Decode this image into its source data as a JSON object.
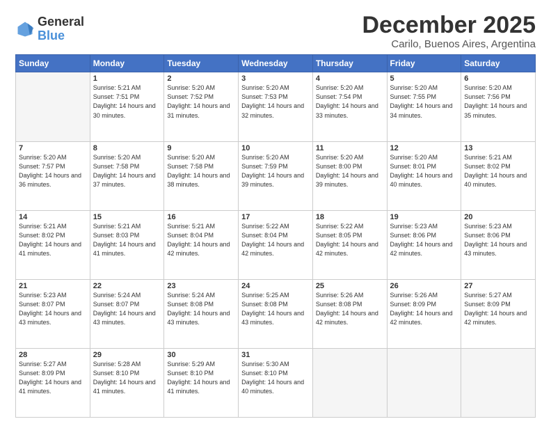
{
  "header": {
    "logo_general": "General",
    "logo_blue": "Blue",
    "title": "December 2025",
    "subtitle": "Carilo, Buenos Aires, Argentina"
  },
  "calendar": {
    "days_of_week": [
      "Sunday",
      "Monday",
      "Tuesday",
      "Wednesday",
      "Thursday",
      "Friday",
      "Saturday"
    ],
    "weeks": [
      [
        {
          "day": "",
          "empty": true
        },
        {
          "day": "1",
          "sunrise": "5:21 AM",
          "sunset": "7:51 PM",
          "daylight": "14 hours and 30 minutes."
        },
        {
          "day": "2",
          "sunrise": "5:20 AM",
          "sunset": "7:52 PM",
          "daylight": "14 hours and 31 minutes."
        },
        {
          "day": "3",
          "sunrise": "5:20 AM",
          "sunset": "7:53 PM",
          "daylight": "14 hours and 32 minutes."
        },
        {
          "day": "4",
          "sunrise": "5:20 AM",
          "sunset": "7:54 PM",
          "daylight": "14 hours and 33 minutes."
        },
        {
          "day": "5",
          "sunrise": "5:20 AM",
          "sunset": "7:55 PM",
          "daylight": "14 hours and 34 minutes."
        },
        {
          "day": "6",
          "sunrise": "5:20 AM",
          "sunset": "7:56 PM",
          "daylight": "14 hours and 35 minutes."
        }
      ],
      [
        {
          "day": "7",
          "sunrise": "5:20 AM",
          "sunset": "7:57 PM",
          "daylight": "14 hours and 36 minutes."
        },
        {
          "day": "8",
          "sunrise": "5:20 AM",
          "sunset": "7:58 PM",
          "daylight": "14 hours and 37 minutes."
        },
        {
          "day": "9",
          "sunrise": "5:20 AM",
          "sunset": "7:58 PM",
          "daylight": "14 hours and 38 minutes."
        },
        {
          "day": "10",
          "sunrise": "5:20 AM",
          "sunset": "7:59 PM",
          "daylight": "14 hours and 39 minutes."
        },
        {
          "day": "11",
          "sunrise": "5:20 AM",
          "sunset": "8:00 PM",
          "daylight": "14 hours and 39 minutes."
        },
        {
          "day": "12",
          "sunrise": "5:20 AM",
          "sunset": "8:01 PM",
          "daylight": "14 hours and 40 minutes."
        },
        {
          "day": "13",
          "sunrise": "5:21 AM",
          "sunset": "8:02 PM",
          "daylight": "14 hours and 40 minutes."
        }
      ],
      [
        {
          "day": "14",
          "sunrise": "5:21 AM",
          "sunset": "8:02 PM",
          "daylight": "14 hours and 41 minutes."
        },
        {
          "day": "15",
          "sunrise": "5:21 AM",
          "sunset": "8:03 PM",
          "daylight": "14 hours and 41 minutes."
        },
        {
          "day": "16",
          "sunrise": "5:21 AM",
          "sunset": "8:04 PM",
          "daylight": "14 hours and 42 minutes."
        },
        {
          "day": "17",
          "sunrise": "5:22 AM",
          "sunset": "8:04 PM",
          "daylight": "14 hours and 42 minutes."
        },
        {
          "day": "18",
          "sunrise": "5:22 AM",
          "sunset": "8:05 PM",
          "daylight": "14 hours and 42 minutes."
        },
        {
          "day": "19",
          "sunrise": "5:23 AM",
          "sunset": "8:06 PM",
          "daylight": "14 hours and 42 minutes."
        },
        {
          "day": "20",
          "sunrise": "5:23 AM",
          "sunset": "8:06 PM",
          "daylight": "14 hours and 43 minutes."
        }
      ],
      [
        {
          "day": "21",
          "sunrise": "5:23 AM",
          "sunset": "8:07 PM",
          "daylight": "14 hours and 43 minutes."
        },
        {
          "day": "22",
          "sunrise": "5:24 AM",
          "sunset": "8:07 PM",
          "daylight": "14 hours and 43 minutes."
        },
        {
          "day": "23",
          "sunrise": "5:24 AM",
          "sunset": "8:08 PM",
          "daylight": "14 hours and 43 minutes."
        },
        {
          "day": "24",
          "sunrise": "5:25 AM",
          "sunset": "8:08 PM",
          "daylight": "14 hours and 43 minutes."
        },
        {
          "day": "25",
          "sunrise": "5:26 AM",
          "sunset": "8:08 PM",
          "daylight": "14 hours and 42 minutes."
        },
        {
          "day": "26",
          "sunrise": "5:26 AM",
          "sunset": "8:09 PM",
          "daylight": "14 hours and 42 minutes."
        },
        {
          "day": "27",
          "sunrise": "5:27 AM",
          "sunset": "8:09 PM",
          "daylight": "14 hours and 42 minutes."
        }
      ],
      [
        {
          "day": "28",
          "sunrise": "5:27 AM",
          "sunset": "8:09 PM",
          "daylight": "14 hours and 41 minutes."
        },
        {
          "day": "29",
          "sunrise": "5:28 AM",
          "sunset": "8:10 PM",
          "daylight": "14 hours and 41 minutes."
        },
        {
          "day": "30",
          "sunrise": "5:29 AM",
          "sunset": "8:10 PM",
          "daylight": "14 hours and 41 minutes."
        },
        {
          "day": "31",
          "sunrise": "5:30 AM",
          "sunset": "8:10 PM",
          "daylight": "14 hours and 40 minutes."
        },
        {
          "day": "",
          "empty": true
        },
        {
          "day": "",
          "empty": true
        },
        {
          "day": "",
          "empty": true
        }
      ]
    ]
  }
}
